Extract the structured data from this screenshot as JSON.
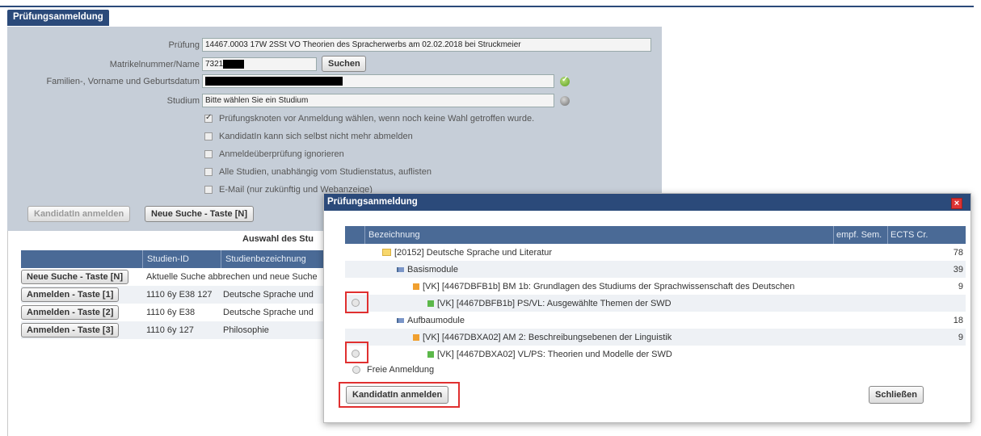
{
  "page": {
    "title": "Prüfungsanmeldung"
  },
  "form": {
    "pruefung_label": "Prüfung",
    "pruefung_value": "14467.0003 17W 2SSt VO Theorien des Spracherwerbs am 02.02.2018  bei Struckmeier",
    "matrikel_label": "Matrikelnummer/Name",
    "matrikel_value": "7321",
    "search_label": "Suchen",
    "name_label": "Familien-, Vorname und Geburtsdatum",
    "studium_label": "Studium",
    "studium_value": "Bitte wählen Sie ein Studium",
    "checkboxes": [
      {
        "label": "Prüfungsknoten vor Anmeldung wählen, wenn noch keine Wahl getroffen wurde.",
        "checked": true
      },
      {
        "label": "KandidatIn kann sich selbst nicht mehr abmelden",
        "checked": false
      },
      {
        "label": "Anmeldeüberprüfung ignorieren",
        "checked": false
      },
      {
        "label": "Alle Studien, unabhängig vom Studienstatus, auflisten",
        "checked": false
      },
      {
        "label": "E-Mail (nur zukünftig und Webanzeige)",
        "checked": false
      }
    ],
    "register_label": "KandidatIn anmelden",
    "new_search_label": "Neue Suche - Taste [N]"
  },
  "results": {
    "title": "Auswahl des Stu",
    "headers": [
      "",
      "Studien-ID",
      "Studienbezeichnung"
    ],
    "rows": [
      {
        "button": "Neue Suche - Taste [N]",
        "id": "Aktuelle Suche abbrechen und neue Suche",
        "name": ""
      },
      {
        "button": "Anmelden - Taste [1]",
        "id": "1110 6y E38 127",
        "name": "Deutsche Sprache und"
      },
      {
        "button": "Anmelden - Taste [2]",
        "id": "1110 6y E38",
        "name": "Deutsche Sprache und"
      },
      {
        "button": "Anmelden - Taste [3]",
        "id": "1110 6y 127",
        "name": "Philosophie"
      }
    ]
  },
  "dialog": {
    "title": "Prüfungsanmeldung",
    "close_label": "×",
    "headers": {
      "name": "Bezeichnung",
      "sem": "empf. Sem.",
      "ects": "ECTS Cr."
    },
    "rows": [
      {
        "indent": 0,
        "icon": "folder",
        "label": "[20152] Deutsche Sprache und Literatur",
        "ects": "78",
        "radio": false
      },
      {
        "indent": 1,
        "icon": "module",
        "label": "Basismodule",
        "ects": "39",
        "radio": false
      },
      {
        "indent": 2,
        "icon": "orange",
        "label": "[VK] [4467DBFB1b] BM 1b: Grundlagen des Studiums der Sprachwissenschaft des Deutschen",
        "ects": "9",
        "radio": false
      },
      {
        "indent": 3,
        "icon": "green",
        "label": "[VK] [4467DBFB1b] PS/VL: Ausgewählte Themen der SWD",
        "ects": "",
        "radio": true
      },
      {
        "indent": 1,
        "icon": "module",
        "label": "Aufbaumodule",
        "ects": "18",
        "radio": false
      },
      {
        "indent": 2,
        "icon": "orange",
        "label": "[VK] [4467DBXA02] AM 2: Beschreibungsebenen der Linguistik",
        "ects": "9",
        "radio": false
      },
      {
        "indent": 3,
        "icon": "green",
        "label": "[VK] [4467DBXA02] VL/PS: Theorien und Modelle der SWD",
        "ects": "",
        "radio": true
      }
    ],
    "free_label": "Freie Anmeldung",
    "register_label": "KandidatIn anmelden",
    "close_button_label": "Schließen"
  }
}
